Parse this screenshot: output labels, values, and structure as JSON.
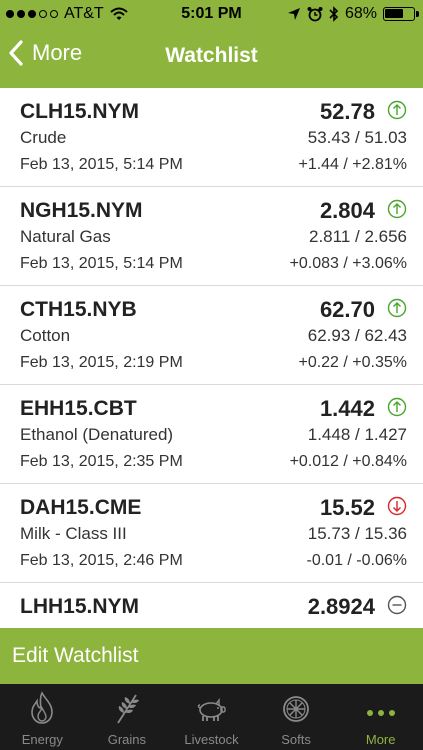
{
  "status": {
    "carrier": "AT&T",
    "time": "5:01 PM",
    "battery": "68%",
    "battery_level": 0.68
  },
  "nav": {
    "back_label": "More",
    "title": "Watchlist"
  },
  "colors": {
    "brand": "#8db43c",
    "up": "#4aa52e",
    "down": "#d9262b",
    "neutral": "#555555",
    "tabbar": "#1b1b1b"
  },
  "watchlist": [
    {
      "symbol": "CLH15.NYM",
      "name": "Crude",
      "date": "Feb 13, 2015, 5:14 PM",
      "price": "52.78",
      "high_low": "53.43 / 51.03",
      "change": "+1.44 / +2.81%",
      "trend": "up"
    },
    {
      "symbol": "NGH15.NYM",
      "name": "Natural Gas",
      "date": "Feb 13, 2015, 5:14 PM",
      "price": "2.804",
      "high_low": "2.811 / 2.656",
      "change": "+0.083 / +3.06%",
      "trend": "up"
    },
    {
      "symbol": "CTH15.NYB",
      "name": "Cotton",
      "date": "Feb 13, 2015, 2:19 PM",
      "price": "62.70",
      "high_low": "62.93 / 62.43",
      "change": "+0.22 / +0.35%",
      "trend": "up"
    },
    {
      "symbol": "EHH15.CBT",
      "name": "Ethanol (Denatured)",
      "date": "Feb 13, 2015, 2:35 PM",
      "price": "1.442",
      "high_low": "1.448 / 1.427",
      "change": "+0.012 / +0.84%",
      "trend": "up"
    },
    {
      "symbol": "DAH15.CME",
      "name": "Milk - Class III",
      "date": "Feb 13, 2015, 2:46 PM",
      "price": "15.52",
      "high_low": "15.73 / 15.36",
      "change": "-0.01 / -0.06%",
      "trend": "down"
    },
    {
      "symbol": "LHH15.NYM",
      "name": "",
      "date": "",
      "price": "2.8924",
      "high_low": "",
      "change": "",
      "trend": "neutral"
    }
  ],
  "edit_label": "Edit Watchlist",
  "tabs": [
    {
      "label": "Energy",
      "icon": "flame-icon",
      "active": false
    },
    {
      "label": "Grains",
      "icon": "wheat-icon",
      "active": false
    },
    {
      "label": "Livestock",
      "icon": "pig-icon",
      "active": false
    },
    {
      "label": "Softs",
      "icon": "orange-slice-icon",
      "active": false
    },
    {
      "label": "More",
      "icon": "more-dots-icon",
      "active": true
    }
  ]
}
